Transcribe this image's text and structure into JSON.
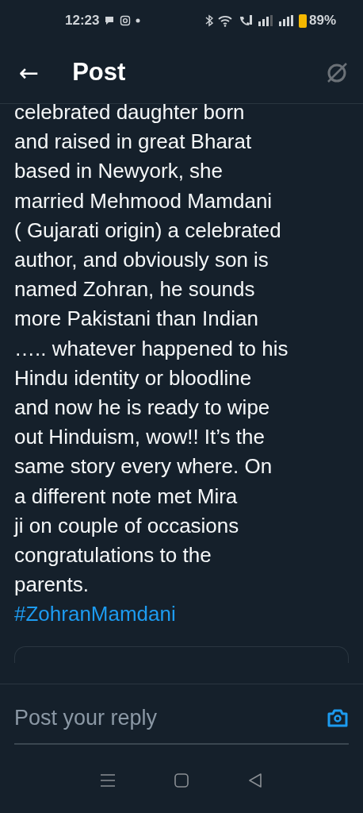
{
  "status_bar": {
    "time": "12:23",
    "battery": "89%"
  },
  "header": {
    "back": "←",
    "title": "Post"
  },
  "post": {
    "text": "celebrated daughter born\nand raised in great Bharat\nbased in Newyork, she\nmarried Mehmood Mamdani\n( Gujarati origin) a celebrated\nauthor, and obviously son is\nnamed Zohran, he sounds\nmore Pakistani than Indian\n….. whatever happened to his\nHindu identity or bloodline\nand now he is ready to wipe\nout Hinduism, wow!! It’s the\nsame story every where. On\na different note met Mira\nji on couple of occasions\ncongratulations to the\nparents.",
    "hashtag": "#ZohranMamdani"
  },
  "reply": {
    "placeholder": "Post your reply"
  }
}
